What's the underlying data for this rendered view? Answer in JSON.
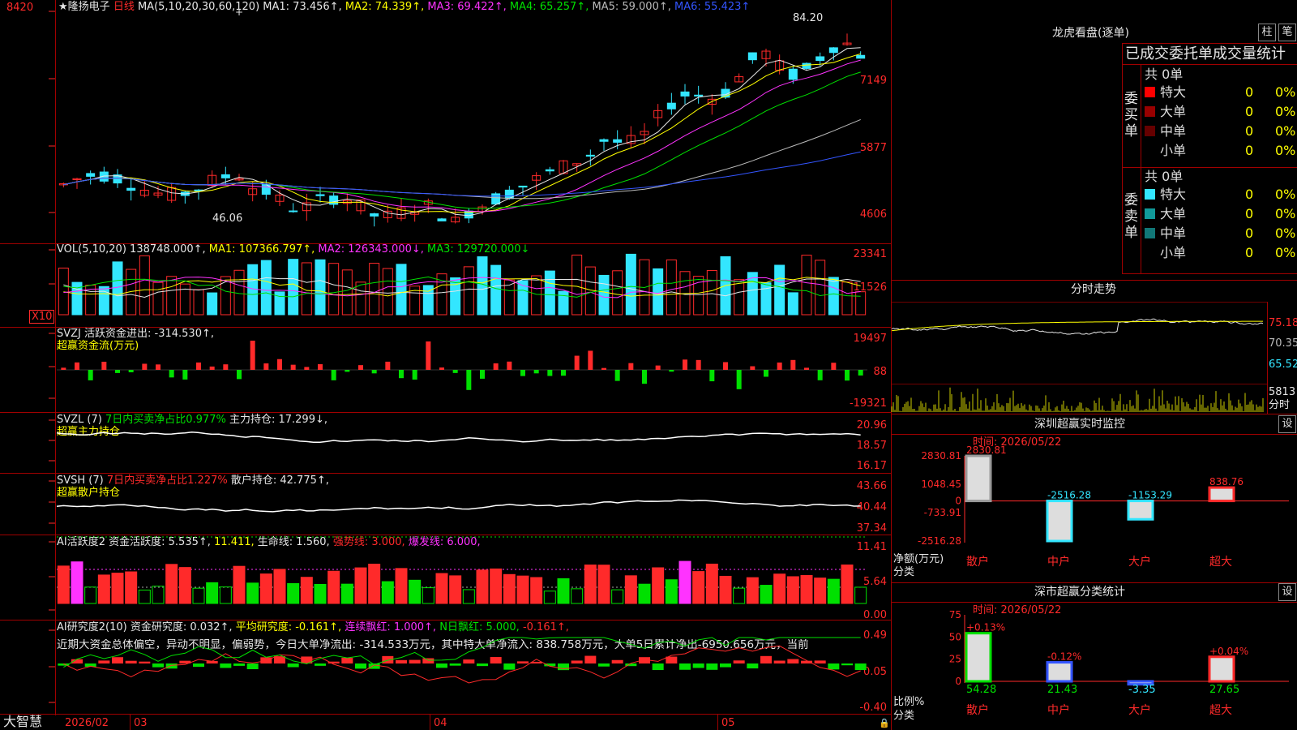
{
  "stock": {
    "name": "隆扬电子",
    "period": "日线",
    "star": "★"
  },
  "main_chart": {
    "ma_label": "MA(5,10,20,30,60,120)",
    "ma_values": [
      {
        "text": "MA1: 73.456↑,",
        "color": "#e6e6e6"
      },
      {
        "text": "MA2: 74.339↑,",
        "color": "#ffff00"
      },
      {
        "text": "MA3: 69.422↑,",
        "color": "#ff33ff"
      },
      {
        "text": "MA4: 65.257↑,",
        "color": "#00e000"
      },
      {
        "text": "MA5: 59.000↑,",
        "color": "#bbbbbb"
      },
      {
        "text": "MA6: 55.423↑",
        "color": "#3355ff"
      }
    ],
    "y_ticks": [
      "8420",
      "7149",
      "5877",
      "4606"
    ],
    "high_mark": "84.20",
    "low_mark": "46.06",
    "series_colors": [
      "#e6e6e6",
      "#ffff00",
      "#ff33ff",
      "#00e000",
      "#bbbbbb",
      "#3355ff"
    ]
  },
  "vol_panel": {
    "title": "VOL(5,10,20)",
    "values": [
      {
        "text": "138748.000↑,",
        "color": "#e6e6e6"
      },
      {
        "text": "MA1: 107366.797↑,",
        "color": "#ffff00"
      },
      {
        "text": "MA2: 126343.000↓,",
        "color": "#ff33ff"
      },
      {
        "text": "MA3: 129720.000↓",
        "color": "#00e000"
      }
    ],
    "y_ticks": [
      "23341",
      "11526"
    ],
    "unit": "X10"
  },
  "svzj_panel": {
    "title": "SVZJ  活跃资金进出: -314.530↑,",
    "subtitle": "超赢资金流(万元)",
    "y_ticks": [
      "19497",
      "88",
      "-19321"
    ]
  },
  "svzl_panel": {
    "title_a": "SVZL (7)",
    "title_b": "7日内买卖净占比0.977%",
    "title_c": "主力持仓: 17.299↓,",
    "subtitle": "超赢主力持仓",
    "y_ticks": [
      "20.96",
      "18.57",
      "16.17"
    ]
  },
  "svsh_panel": {
    "title_a": "SVSH (7)",
    "title_b": "7日内买卖净占比1.227%",
    "title_c": "散户持仓: 42.775↑,",
    "subtitle": "超赢散户持仓",
    "y_ticks": [
      "43.66",
      "40.44",
      "37.34"
    ]
  },
  "ai_act_panel": {
    "title": "AI活跃度2 资金活跃度: 5.535↑,",
    "v1": "11.411,",
    "v2": "生命线: 1.560,",
    "v3": "强势线: 3.000,",
    "v4": "爆发线: 6.000,",
    "y_ticks": [
      "11.41",
      "5.64",
      "0.00"
    ]
  },
  "ai_res_panel": {
    "title": "AI研究度2(10) 资金研究度: 0.032↑,",
    "v1": "平均研究度: -0.161↑,",
    "v2": "连续飘红: 1.000↑,",
    "v3": "N日飘红: 5.000,",
    "v4": "-0.161↑,",
    "comment": "近期大资金总体偏空，异动不明显，偏弱势，今日大单净流出: -314.533万元，其中特大单净流入: 838.758万元，大单5日累计净出-6950.656万元，当前",
    "y_ticks": [
      "0.49",
      "0.05",
      "-0.40"
    ]
  },
  "x_axis": {
    "brand": "大智慧",
    "labels": [
      "2026/02",
      "03",
      "04",
      "05"
    ]
  },
  "dragon_tiger": {
    "title": "龙虎看盘(逐单)",
    "btn1": "柱",
    "btn2": "笔",
    "header": "已成交委托单成交量统计",
    "buy_side": "委买单",
    "sell_side": "委卖单",
    "buy_total": "共 0单",
    "sell_total": "共 0单",
    "buy_rows": [
      {
        "label": "特大",
        "count": "0",
        "pct": "0%",
        "color": "#ff0000"
      },
      {
        "label": "大单",
        "count": "0",
        "pct": "0%",
        "color": "#990000"
      },
      {
        "label": "中单",
        "count": "0",
        "pct": "0%",
        "color": "#660000"
      },
      {
        "label": "小单",
        "count": "0",
        "pct": "0%",
        "color": ""
      }
    ],
    "sell_rows": [
      {
        "label": "特大",
        "count": "0",
        "pct": "0%",
        "color": "#33e6ff"
      },
      {
        "label": "大单",
        "count": "0",
        "pct": "0%",
        "color": "#119999"
      },
      {
        "label": "中单",
        "count": "0",
        "pct": "0%",
        "color": "#117777"
      },
      {
        "label": "小单",
        "count": "0",
        "pct": "0%",
        "color": ""
      }
    ]
  },
  "intraday": {
    "title": "分时走势",
    "y_ticks": [
      "75.18",
      "70.35",
      "65.52"
    ],
    "vol_tick": "5813",
    "vol_unit": "分时"
  },
  "sz_monitor": {
    "title": "深圳超赢实时监控",
    "btn": "设",
    "date": "时间: 2026/05/22",
    "y_ticks": [
      "2830.81",
      "1048.45",
      "0",
      "-733.91",
      "-2516.28"
    ],
    "ylabel1": "净额(万元)",
    "ylabel2": "分类",
    "categories": [
      "散户",
      "中户",
      "大户",
      "超大"
    ],
    "values": [
      2830.81,
      -2516.28,
      -1153.29,
      838.76
    ],
    "value_labels": [
      "2830.81",
      "-2516.28",
      "-1153.29",
      "838.76"
    ]
  },
  "sz_class": {
    "title": "深市超赢分类统计",
    "btn": "设",
    "date": "时间: 2026/05/22",
    "y_ticks": [
      "75",
      "50",
      "25",
      "0"
    ],
    "ylabel1": "比例%",
    "ylabel2": "分类",
    "categories": [
      "散户",
      "中户",
      "大户",
      "超大"
    ],
    "values": [
      54.28,
      21.43,
      -3.35,
      27.65
    ],
    "value_labels": [
      "54.28",
      "21.43",
      "-3.35",
      "27.65"
    ],
    "change_labels": [
      "+0.13%",
      "-0.12%",
      "",
      "+0.04%"
    ]
  }
}
